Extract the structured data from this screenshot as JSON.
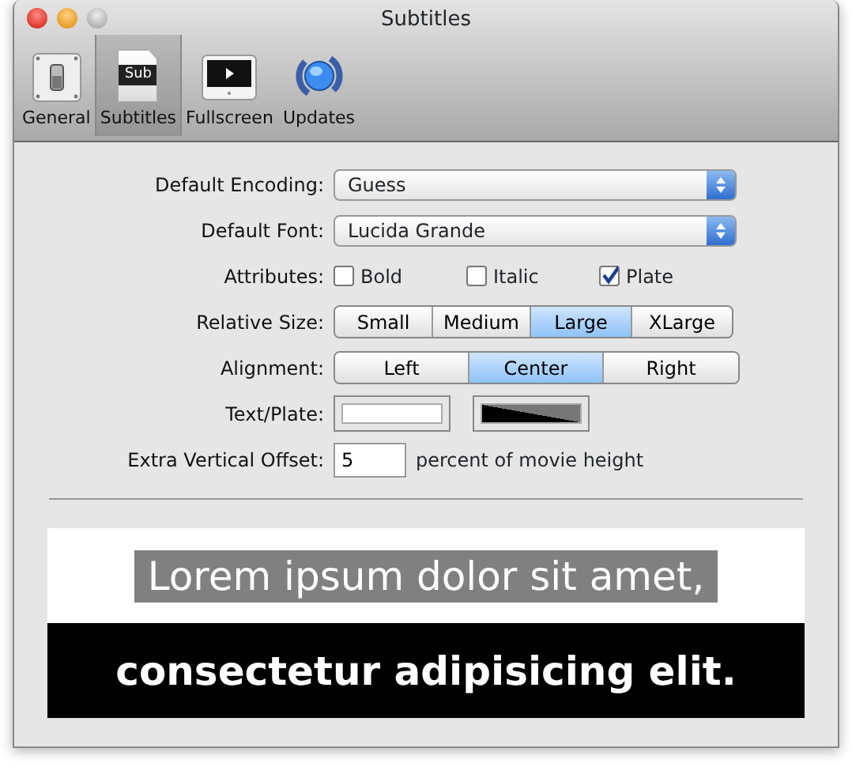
{
  "window": {
    "title": "Subtitles"
  },
  "toolbar": [
    {
      "label": "General",
      "kind": "switch",
      "selected": false
    },
    {
      "label": "Subtitles",
      "kind": "document",
      "icon_text": "Sub",
      "selected": true
    },
    {
      "label": "Fullscreen",
      "kind": "display",
      "selected": false
    },
    {
      "label": "Updates",
      "kind": "globe",
      "selected": false
    }
  ],
  "form": {
    "encoding": {
      "label": "Default Encoding:",
      "value": "Guess"
    },
    "font": {
      "label": "Default Font:",
      "value": "Lucida Grande"
    },
    "attributes": {
      "label": "Attributes:",
      "options": [
        {
          "label": "Bold",
          "checked": false
        },
        {
          "label": "Italic",
          "checked": false
        },
        {
          "label": "Plate",
          "checked": true
        }
      ]
    },
    "relative_size": {
      "label": "Relative Size:",
      "options": [
        {
          "label": "Small",
          "selected": false
        },
        {
          "label": "Medium",
          "selected": false
        },
        {
          "label": "Large",
          "selected": true
        },
        {
          "label": "XLarge",
          "selected": false
        }
      ]
    },
    "alignment": {
      "label": "Alignment:",
      "options": [
        {
          "label": "Left",
          "selected": false
        },
        {
          "label": "Center",
          "selected": true
        },
        {
          "label": "Right",
          "selected": false
        }
      ]
    },
    "text_plate": {
      "label": "Text/Plate:",
      "wells": [
        {
          "color": "#ffffff"
        },
        {
          "color": "#000000"
        }
      ]
    },
    "offset": {
      "label": "Extra Vertical Offset:",
      "value": "5",
      "suffix": "percent of movie height"
    }
  },
  "preview": [
    {
      "text": "Lorem ipsum dolor sit amet,",
      "bold": false,
      "color": "#808080"
    },
    {
      "text": "consectetur adipisicing elit.",
      "bold": true,
      "color": "#000000"
    }
  ]
}
